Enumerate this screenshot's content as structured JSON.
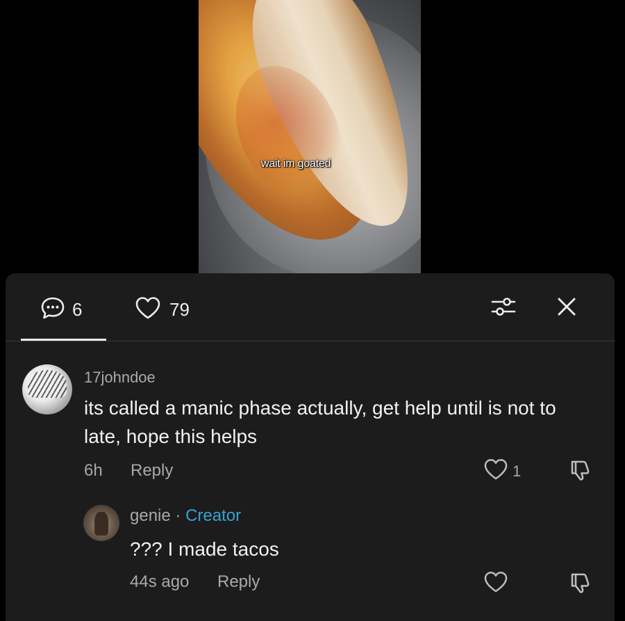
{
  "video": {
    "caption": "wait im goated"
  },
  "tabs": {
    "comment_count": "6",
    "like_count": "79",
    "comment_icon": "comment-bubble-icon",
    "like_icon": "heart-icon",
    "filter_icon": "filter-sliders-icon",
    "close_icon": "close-icon"
  },
  "comments": [
    {
      "username": "17johndoe",
      "text": "its called a manic phase actually, get help until is not to late, hope this helps",
      "time": "6h",
      "reply_label": "Reply",
      "likes": "1"
    }
  ],
  "reply": {
    "username": "genie",
    "separator": " · ",
    "badge": "Creator",
    "text": "??? I made tacos",
    "time": "44s ago",
    "reply_label": "Reply"
  },
  "colors": {
    "background": "#000000",
    "sheet": "#1c1c1c",
    "creator_badge": "#35a3d4",
    "secondary_text": "#a9a9a9",
    "primary_text": "#f1f1f1"
  }
}
